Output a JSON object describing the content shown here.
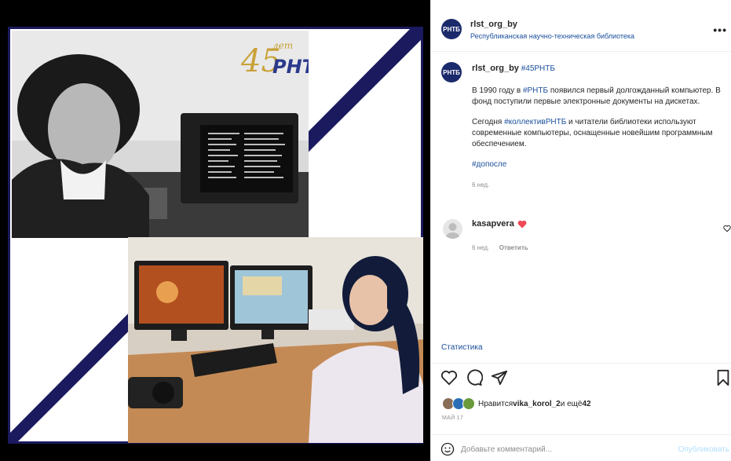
{
  "post": {
    "logo_text": "РНТБ",
    "anniversary_number": "45",
    "anniversary_word": "лет",
    "header": {
      "username": "rlst_org_by",
      "subtitle": "Республиканская научно-техническая библиотека",
      "more_label": "•••"
    },
    "caption": {
      "username": "rlst_org_by",
      "hashtag_title": "#45РНТБ",
      "p1_pre": "В 1990 году в ",
      "p1_tag": "#РНТБ",
      "p1_post": " появился первый долгожданный компьютер. В фонд поступили первые электронные документы на дискетах.",
      "p2_pre": "Сегодня ",
      "p2_tag": "#коллективРНТБ",
      "p2_post": " и читатели библиотеки используют современные компьютеры, оснащенные новейшим программным обеспечением.",
      "p3_tag": "#допосле",
      "time": "6 нед."
    },
    "comment": {
      "username": "kasapvera",
      "time": "6 нед.",
      "reply": "Ответить"
    },
    "stats_link": "Статистика",
    "likes": {
      "prefix": "Нравится ",
      "user": "vika_korol_2",
      "middle": " и ещё ",
      "count": "42"
    },
    "date": "МАЙ 17",
    "add_comment": {
      "placeholder": "Добавьте комментарий...",
      "post_button": "Опубликовать"
    }
  },
  "colors": {
    "navy": "#1b1a5e",
    "link": "#1a4f9c",
    "heart": "#ed4956"
  },
  "icons": [
    "more-icon",
    "heart-small-icon",
    "heart-icon",
    "comment-icon",
    "share-icon",
    "bookmark-icon",
    "emoji-icon"
  ]
}
